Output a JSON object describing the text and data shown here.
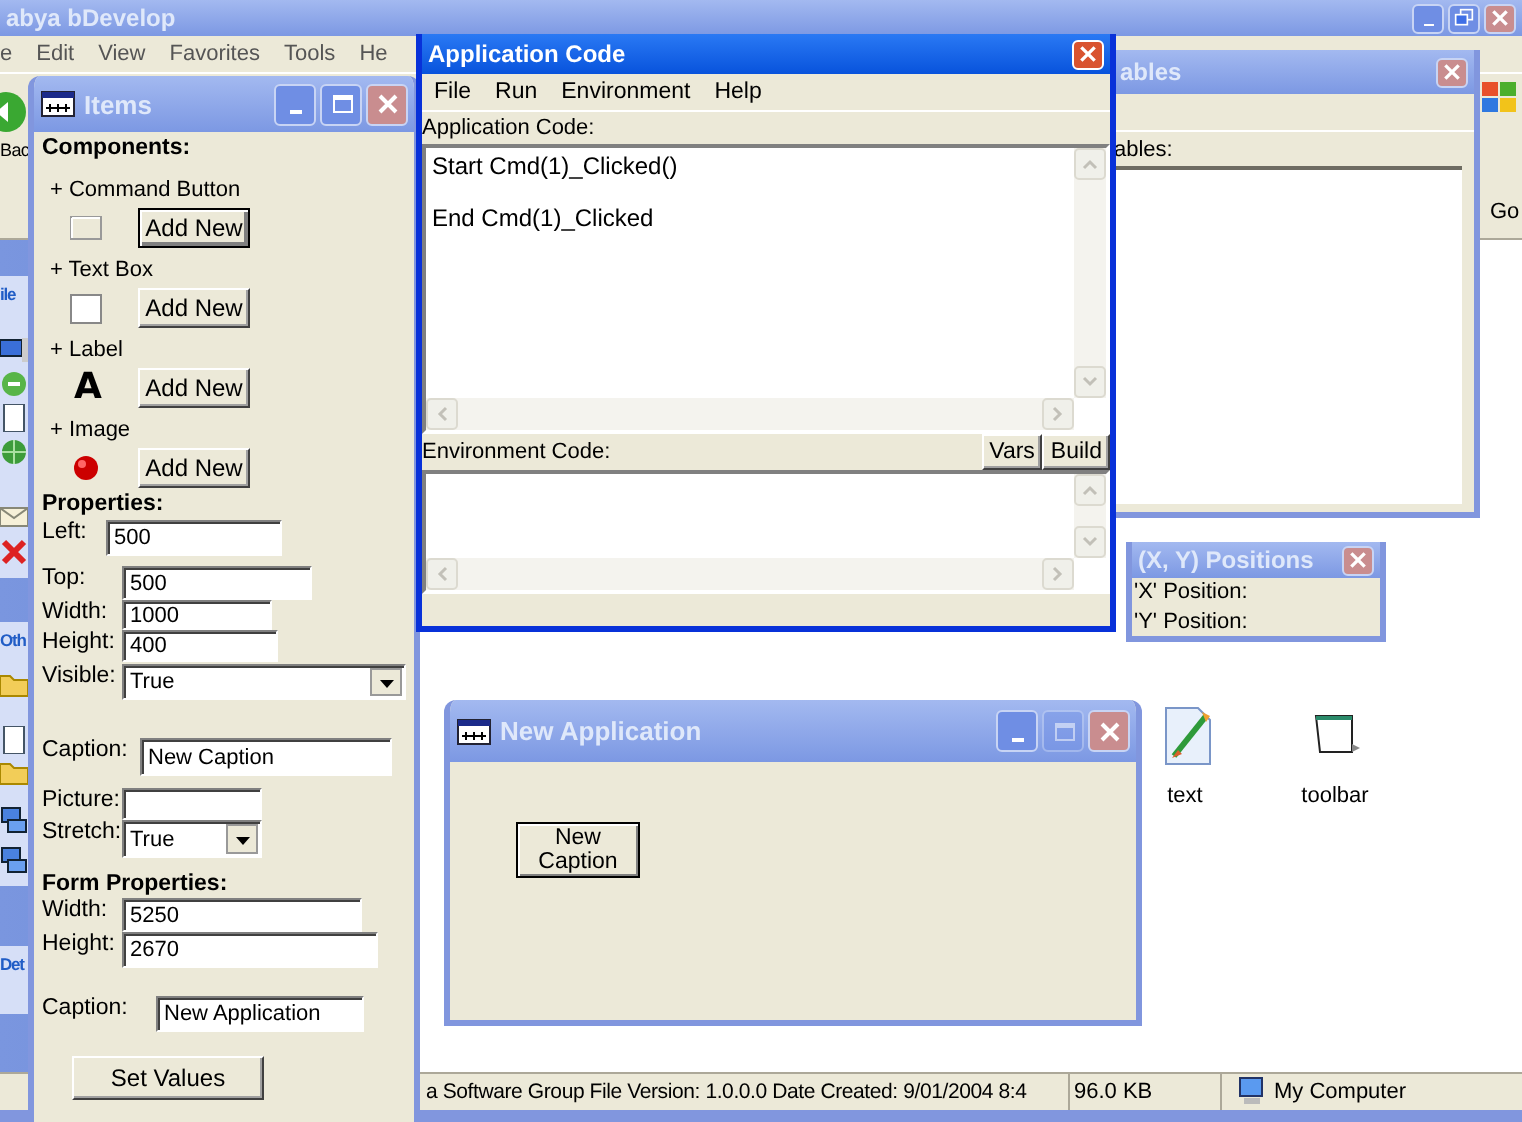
{
  "explorer": {
    "title": "abya bDevelop",
    "active": false,
    "controls": [
      {
        "kind": "minimize",
        "disabled": false
      },
      {
        "kind": "restore",
        "disabled": false
      },
      {
        "kind": "close",
        "disabled": false
      }
    ],
    "menu": [
      "e",
      "Edit",
      "View",
      "Favorites",
      "Tools",
      "He"
    ],
    "back_label": "Bac",
    "go_label": "Go",
    "sidebar_headers": [
      "ile",
      "Oth",
      "Det"
    ],
    "files": [
      {
        "name": "text",
        "kind": "paint"
      },
      {
        "name": "toolbar",
        "kind": "window"
      }
    ],
    "status_bar": {
      "description": "a Software Group File Version: 1.0.0.0 Date Created: 9/01/2004 8:4",
      "size": "96.0 KB",
      "zone": "My Computer"
    }
  },
  "items_window": {
    "title": "Items",
    "active": false,
    "controls": [
      {
        "kind": "minimize",
        "disabled": false
      },
      {
        "kind": "maximize",
        "disabled": false
      },
      {
        "kind": "close",
        "disabled": false
      }
    ],
    "components_heading": "Components:",
    "components": [
      {
        "label": "+ Command Button",
        "kind": "button",
        "action": "Add New",
        "default": true
      },
      {
        "label": "+ Text Box",
        "kind": "textbox",
        "action": "Add New",
        "default": false
      },
      {
        "label": "+ Label",
        "kind": "label",
        "glyph": "A",
        "action": "Add New",
        "default": false
      },
      {
        "label": "+ Image",
        "kind": "image",
        "action": "Add New",
        "default": false
      }
    ],
    "properties_heading": "Properties:",
    "properties": [
      {
        "label": "Left:",
        "kind": "text",
        "value": "500"
      },
      {
        "label": "Top:",
        "kind": "text",
        "value": "500"
      },
      {
        "label": "Width:",
        "kind": "text",
        "value": "1000"
      },
      {
        "label": "Height:",
        "kind": "text",
        "value": "400"
      },
      {
        "label": "Visible:",
        "kind": "dropdown",
        "value": "True"
      },
      {
        "label": "Caption:",
        "kind": "text",
        "value": "New Caption"
      },
      {
        "label": "Picture:",
        "kind": "text"
      },
      {
        "label": "Stretch:",
        "kind": "dropdown",
        "value": "True"
      }
    ],
    "form_heading": "Form Properties:",
    "form_properties": [
      {
        "label": "Width:",
        "kind": "text",
        "value": "5250"
      },
      {
        "label": "Height:",
        "kind": "text",
        "value": "2670"
      },
      {
        "label": "Caption:",
        "kind": "text",
        "value": "New Application"
      }
    ],
    "submit": "Set Values"
  },
  "code_window": {
    "title": "Application Code",
    "active": true,
    "controls": [
      {
        "kind": "close",
        "disabled": false
      }
    ],
    "menu": [
      "File",
      "Run",
      "Environment",
      "Help"
    ],
    "app_label": "Application Code:",
    "app_code": "Start Cmd(1)_Clicked()\n\nEnd Cmd(1)_Clicked",
    "env_label": "Environment Code:",
    "env_buttons": [
      "Vars",
      "Build"
    ]
  },
  "variables_window": {
    "title": "ables",
    "active": false,
    "controls": [
      {
        "kind": "close",
        "disabled": false
      }
    ],
    "list_header": "ables:"
  },
  "positions_window": {
    "title": "(X, Y) Positions",
    "active": false,
    "controls": [
      {
        "kind": "close",
        "disabled": false
      }
    ],
    "rows": [
      "'X' Position:",
      "'Y' Position:"
    ]
  },
  "new_application": {
    "title": "New Application",
    "active": false,
    "controls": [
      {
        "kind": "minimize",
        "disabled": false
      },
      {
        "kind": "maximize",
        "disabled": true
      },
      {
        "kind": "close",
        "disabled": false
      }
    ],
    "button": "New Caption"
  }
}
